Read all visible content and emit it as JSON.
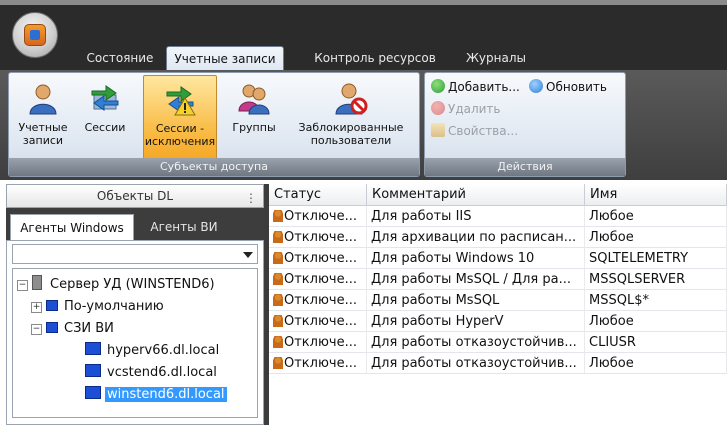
{
  "tabs": [
    {
      "label": "Состояние"
    },
    {
      "label": "Учетные записи"
    },
    {
      "label": "Контроль ресурсов"
    },
    {
      "label": "Журналы"
    }
  ],
  "ribbon": {
    "subjects_group": {
      "label": "Субъекты доступа",
      "buttons": [
        {
          "label": "Учетные записи",
          "icon": "user-icon"
        },
        {
          "label": "Сессии",
          "icon": "sessions-icon"
        },
        {
          "label": "Сессии - исключения",
          "icon": "sessions-exceptions-icon"
        },
        {
          "label": "Группы",
          "icon": "groups-icon"
        },
        {
          "label": "Заблокированные пользователи",
          "icon": "blocked-user-icon"
        }
      ]
    },
    "actions_group": {
      "label": "Действия",
      "add": "Добавить...",
      "refresh": "Обновить",
      "delete": "Удалить",
      "properties": "Свойства..."
    }
  },
  "left_panel": {
    "title": "Объекты DL",
    "tabs": [
      {
        "label": "Агенты Windows"
      },
      {
        "label": "Агенты ВИ"
      }
    ],
    "combo_value": "",
    "tree": {
      "root": "Сервер УД (WINSTEND6)",
      "default_node": "По-умолчанию",
      "szi_node": "СЗИ ВИ",
      "hosts": [
        "hyperv66.dl.local",
        "vcstend6.dl.local",
        "winstend6.dl.local"
      ]
    }
  },
  "grid": {
    "columns": [
      "Статус",
      "Комментарий",
      "Имя"
    ],
    "rows": [
      [
        "Отключе...",
        "Для работы IIS",
        "Любое"
      ],
      [
        "Отключе...",
        "Для архивации по расписан...",
        "Любое"
      ],
      [
        "Отключе...",
        "Для работы Windows 10",
        "SQLTELEMETRY"
      ],
      [
        "Отключе...",
        "Для работы MsSQL / Для ра...",
        "MSSQLSERVER"
      ],
      [
        "Отключе...",
        "Для работы MsSQL",
        "MSSQL$*"
      ],
      [
        "Отключе...",
        "Для работы HyperV",
        "Любое"
      ],
      [
        "Отключе...",
        "Для работы отказоустойчив...",
        "CLIUSR"
      ],
      [
        "Отключе...",
        "Для работы отказоустойчив...",
        "Любое"
      ]
    ]
  },
  "colors": {
    "accent_active": "#f9c04e",
    "selection": "#3399ff",
    "dark_frame": "#2b2b2b"
  }
}
